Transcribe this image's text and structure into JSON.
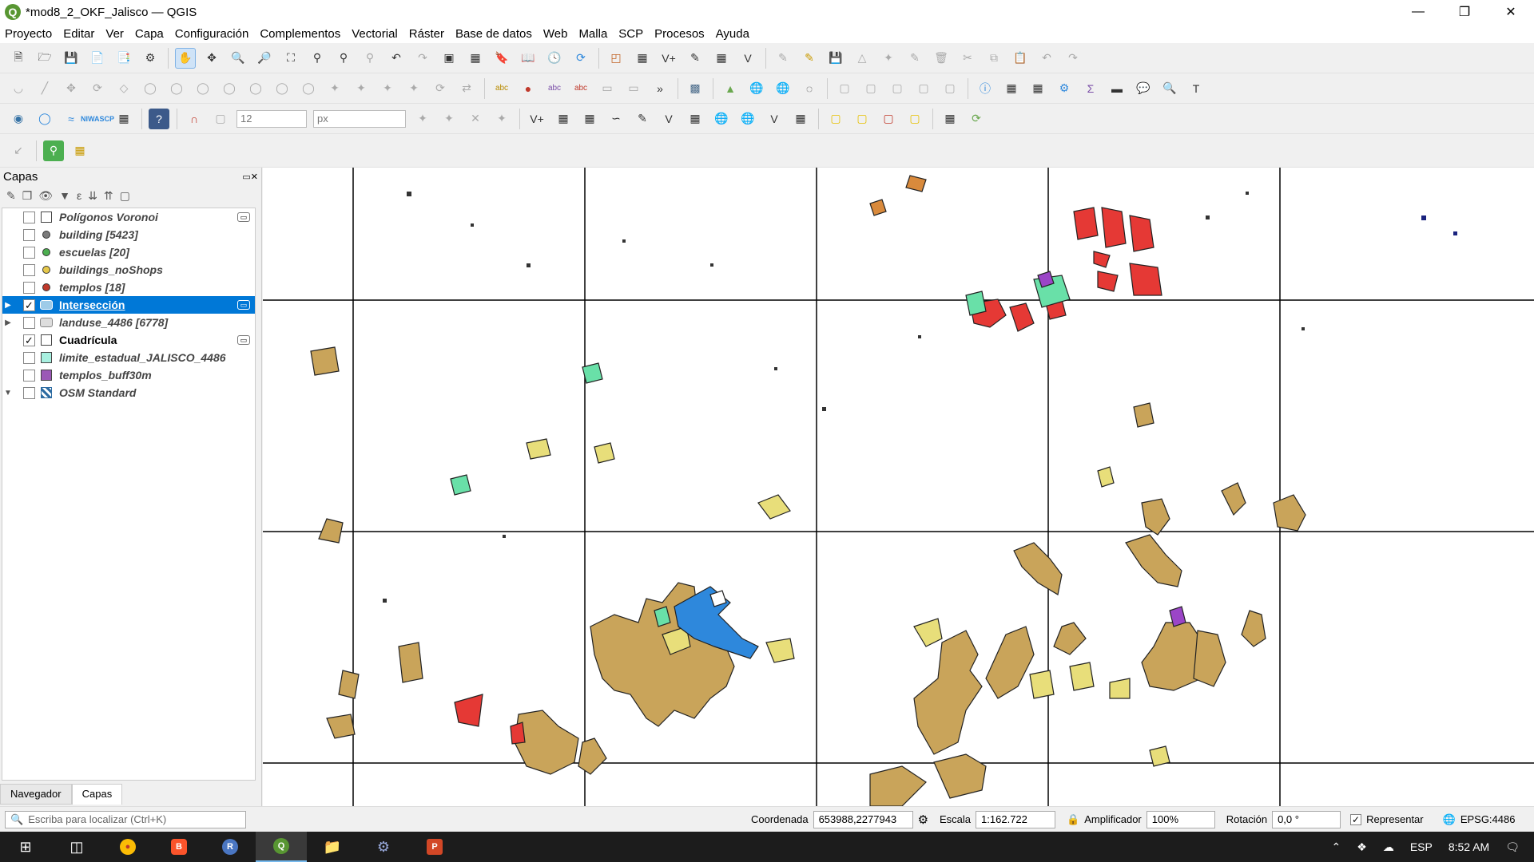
{
  "window": {
    "title": "*mod8_2_OKF_Jalisco — QGIS",
    "app_logo": "Q"
  },
  "menu": [
    "Proyecto",
    "Editar",
    "Ver",
    "Capa",
    "Configuración",
    "Complementos",
    "Vectorial",
    "Ráster",
    "Base de datos",
    "Web",
    "Malla",
    "SCP",
    "Procesos",
    "Ayuda"
  ],
  "toolbar3": {
    "size_value": "12",
    "unit_value": "px",
    "nirs_label": "NIWA",
    "scp_label": "SCP"
  },
  "layers_panel": {
    "title": "Capas",
    "layers": [
      {
        "name": "Polígonos Voronoi",
        "checked": false,
        "symbol": "square",
        "color": "#ffffff",
        "style": "italic"
      },
      {
        "name": "building [5423]",
        "checked": false,
        "symbol": "dot",
        "color": "#7b7b7b",
        "style": "italic"
      },
      {
        "name": "escuelas [20]",
        "checked": false,
        "symbol": "dot",
        "color": "#4caf50",
        "style": "italic"
      },
      {
        "name": "buildings_noShops",
        "checked": false,
        "symbol": "dot",
        "color": "#e6c84a",
        "style": "italic"
      },
      {
        "name": "templos [18]",
        "checked": false,
        "symbol": "dot",
        "color": "#c0392b",
        "style": "italic"
      },
      {
        "name": "Intersección",
        "checked": true,
        "symbol": "polygon",
        "color": "#9ecbe8",
        "style": "selected"
      },
      {
        "name": "landuse_4486 [6778]",
        "checked": false,
        "symbol": "polygon",
        "color": "#dddddd",
        "style": "italic"
      },
      {
        "name": "Cuadrícula",
        "checked": true,
        "symbol": "square",
        "color": "#ffffff",
        "style": "plain"
      },
      {
        "name": "limite_estadual_JALISCO_4486",
        "checked": false,
        "symbol": "square",
        "color": "#a8f0e0",
        "style": "italic"
      },
      {
        "name": "templos_buff30m",
        "checked": false,
        "symbol": "square",
        "color": "#9b59b6",
        "style": "italic"
      },
      {
        "name": "OSM Standard",
        "checked": false,
        "symbol": "grid",
        "color": "#2d6ca2",
        "style": "italic"
      }
    ],
    "tabs": [
      "Navegador",
      "Capas"
    ]
  },
  "map_legend_colors": {
    "landuse": "#c9a45a",
    "residential": "#e8de7a",
    "commercial": "#e53935",
    "education": "#69e0a8",
    "religious": "#9b45c7",
    "industrial": "#2e88dc",
    "misc": "#d98a3c"
  },
  "statusbar": {
    "locator_placeholder": "Escriba para localizar (Ctrl+K)",
    "coord_label": "Coordenada",
    "coord_value": "653988,2277943",
    "scale_label": "Escala",
    "scale_value": "1:162.722",
    "magnifier_label": "Amplificador",
    "magnifier_value": "100%",
    "rotation_label": "Rotación",
    "rotation_value": "0,0 °",
    "render_label": "Representar",
    "crs": "EPSG:4486"
  },
  "taskbar": {
    "lang": "ESP",
    "time": "8:52 AM"
  }
}
